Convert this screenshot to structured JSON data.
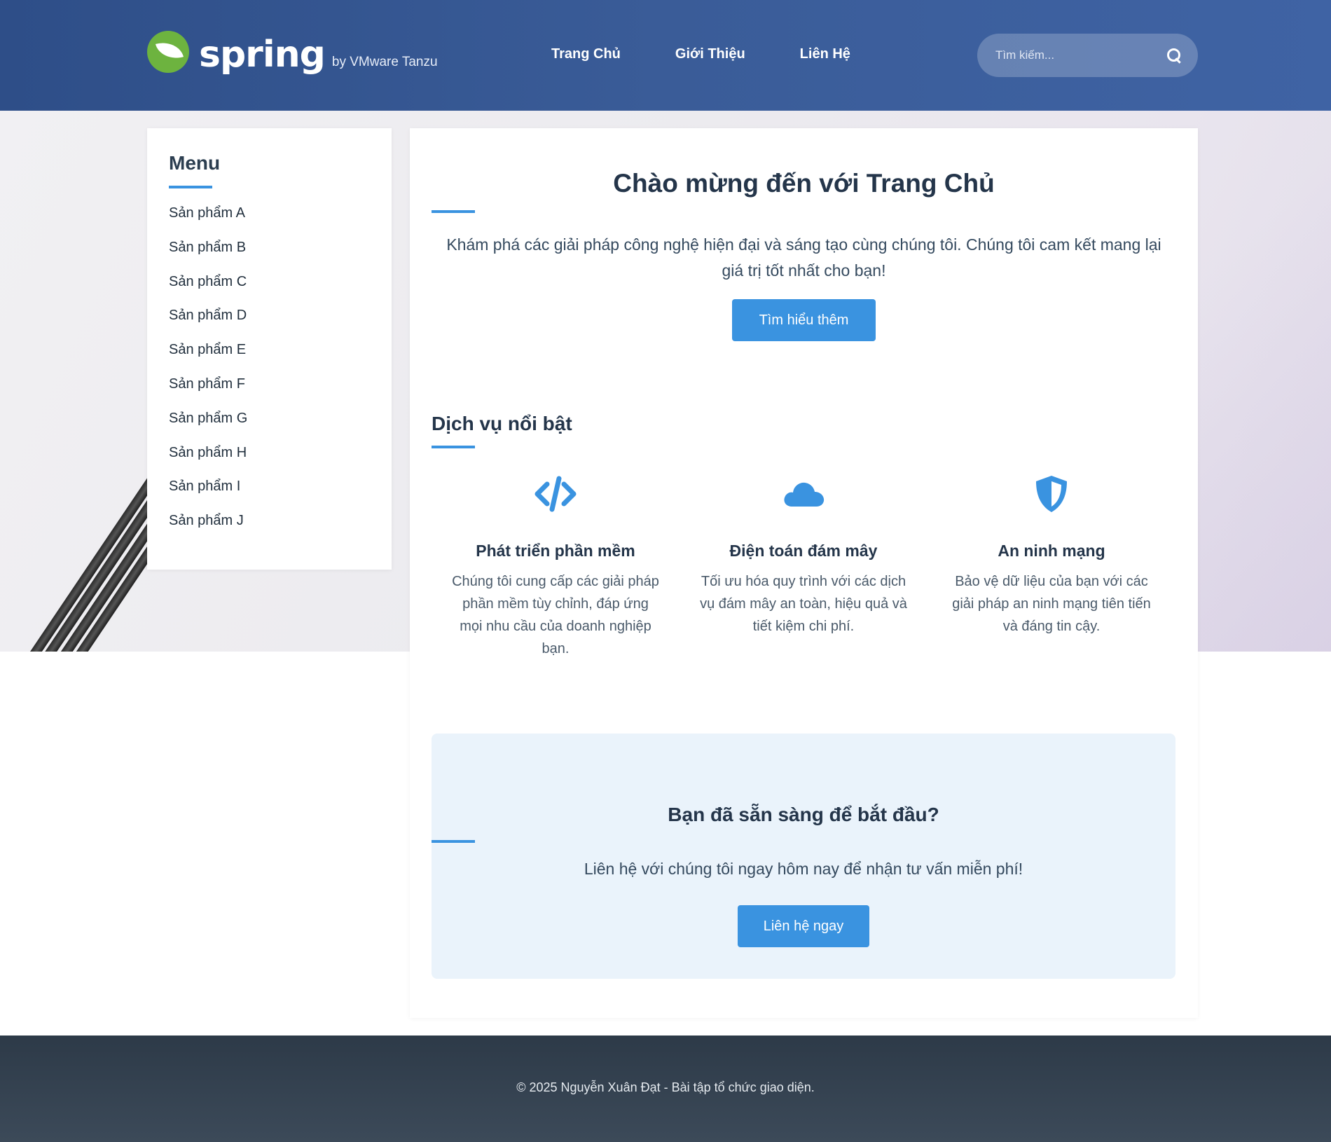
{
  "header": {
    "logo_word": "spring",
    "logo_by": "by VMware Tanzu",
    "nav": [
      "Trang Chủ",
      "Giới Thiệu",
      "Liên Hệ"
    ],
    "search_placeholder": "Tìm kiếm..."
  },
  "sidebar": {
    "title": "Menu",
    "items": [
      "Sản phẩm A",
      "Sản phẩm B",
      "Sản phẩm C",
      "Sản phẩm D",
      "Sản phẩm E",
      "Sản phẩm F",
      "Sản phẩm G",
      "Sản phẩm H",
      "Sản phẩm I",
      "Sản phẩm J"
    ]
  },
  "hero": {
    "title": "Chào mừng đến với Trang Chủ",
    "text": "Khám phá các giải pháp công nghệ hiện đại và sáng tạo cùng chúng tôi. Chúng tôi cam kết mang lại giá trị tốt nhất cho bạn!",
    "button": "Tìm hiểu thêm"
  },
  "services": {
    "title": "Dịch vụ nổi bật",
    "items": [
      {
        "icon": "code-icon",
        "title": "Phát triển phần mềm",
        "text": "Chúng tôi cung cấp các giải pháp phần mềm tùy chỉnh, đáp ứng mọi nhu cầu của doanh nghiệp bạn."
      },
      {
        "icon": "cloud-icon",
        "title": "Điện toán đám mây",
        "text": "Tối ưu hóa quy trình với các dịch vụ đám mây an toàn, hiệu quả và tiết kiệm chi phí."
      },
      {
        "icon": "shield-icon",
        "title": "An ninh mạng",
        "text": "Bảo vệ dữ liệu của bạn với các giải pháp an ninh mạng tiên tiến và đáng tin cậy."
      }
    ]
  },
  "cta": {
    "title": "Bạn đã sẵn sàng để bắt đầu?",
    "text": "Liên hệ với chúng tôi ngay hôm nay để nhận tư vấn miễn phí!",
    "button": "Liên hệ ngay"
  },
  "footer": {
    "text": "© 2025 Nguyễn Xuân Đạt - Bài tập tổ chức giao diện."
  },
  "colors": {
    "header": "#3a5c98",
    "accent": "#3a93e0",
    "footer": "#344250",
    "spring_green": "#6db33f"
  }
}
